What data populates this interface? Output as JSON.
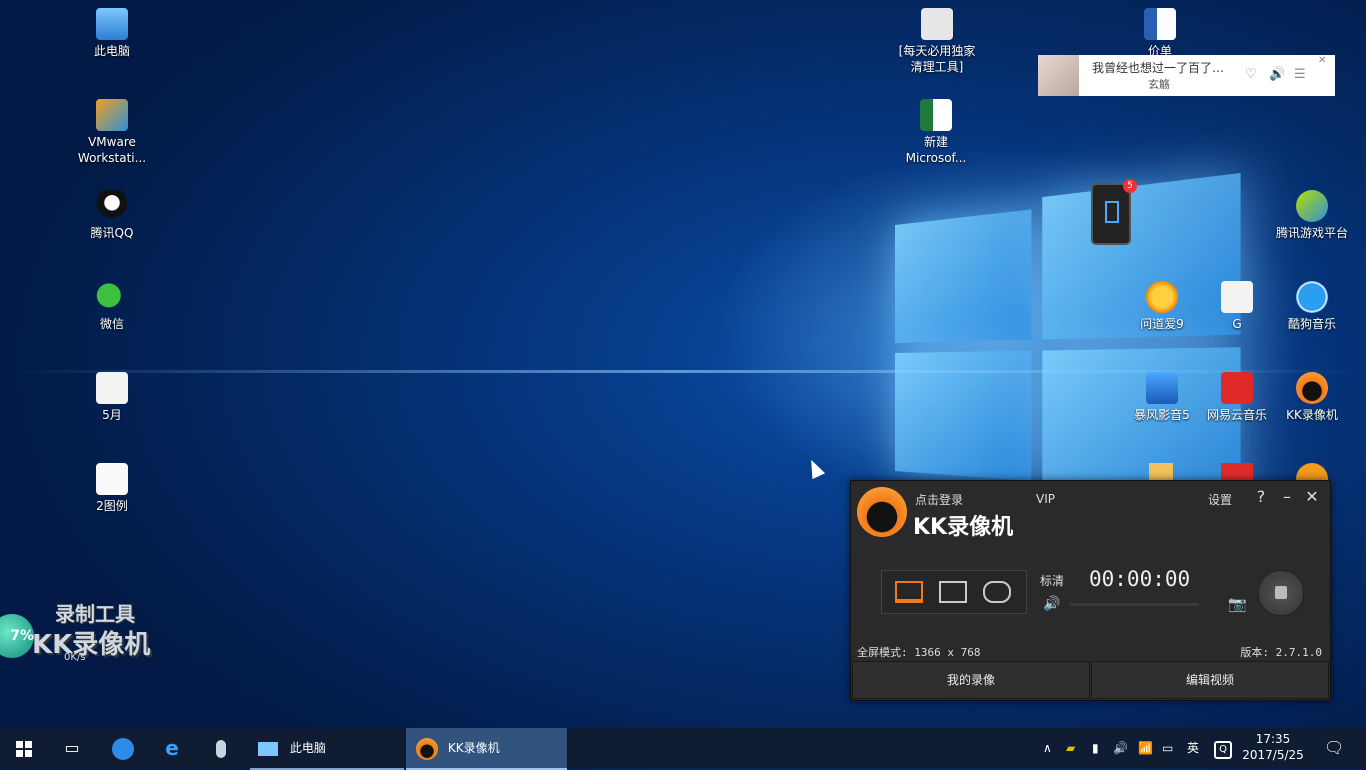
{
  "desktop": {
    "icons_left": [
      {
        "label": "此电脑",
        "icon": "computer-icon"
      },
      {
        "label": "VMware Workstati...",
        "icon": "vmware-icon"
      },
      {
        "label": "腾讯QQ",
        "icon": "qq-icon"
      },
      {
        "label": "微信",
        "icon": "wechat-icon"
      },
      {
        "label": "5月",
        "icon": "file-icon"
      },
      {
        "label": "2图例",
        "icon": "image-file-icon"
      }
    ],
    "icons_top": [
      {
        "label": "[每天必用独家清理工具]",
        "icon": "settings-file-icon"
      },
      {
        "label": "新建 Microsof...",
        "icon": "excel-icon"
      },
      {
        "label": "价单",
        "icon": "word-icon"
      }
    ],
    "icons_right": [
      {
        "label": "腾讯游戏平台",
        "icon": "tencent-game-icon"
      },
      {
        "label": "问道爱9",
        "icon": "game-sun-icon"
      },
      {
        "label": "G",
        "icon": "file-icon"
      },
      {
        "label": "酷狗音乐",
        "icon": "kugou-icon"
      },
      {
        "label": "暴风影音5",
        "icon": "baofeng-icon"
      },
      {
        "label": "网易云音乐",
        "icon": "netease-music-icon"
      },
      {
        "label": "KK录像机",
        "icon": "kk-recorder-icon"
      }
    ]
  },
  "music_widget": {
    "song": "我曾经也想过一了百了…",
    "artist": "玄觞",
    "controls": [
      "heart-icon",
      "volume-icon",
      "list-icon"
    ]
  },
  "phone_widget": {
    "badge": "5"
  },
  "recorder_brand": {
    "line1": "录制工具",
    "line2": "KK录像机",
    "percent": "7%",
    "speed": "0K/s"
  },
  "kk_window": {
    "login": "点击登录",
    "vip": "VIP",
    "title": "KK录像机",
    "settings": "设置",
    "help": "?",
    "minimize": "–",
    "close": "✕",
    "quality": "标清",
    "timer": "00:00:00",
    "mode_info": "全屏模式: 1366 x 768",
    "version": "版本: 2.7.1.0",
    "my_recordings": "我的录像",
    "edit_video": "编辑视频",
    "accent": "#f07a1a"
  },
  "taskbar": {
    "apps": [
      {
        "label": "此电脑",
        "icon": "computer-icon"
      },
      {
        "label": "KK录像机",
        "icon": "kk-recorder-icon"
      }
    ],
    "ime": "英",
    "time": "17:35",
    "date": "2017/5/25"
  }
}
